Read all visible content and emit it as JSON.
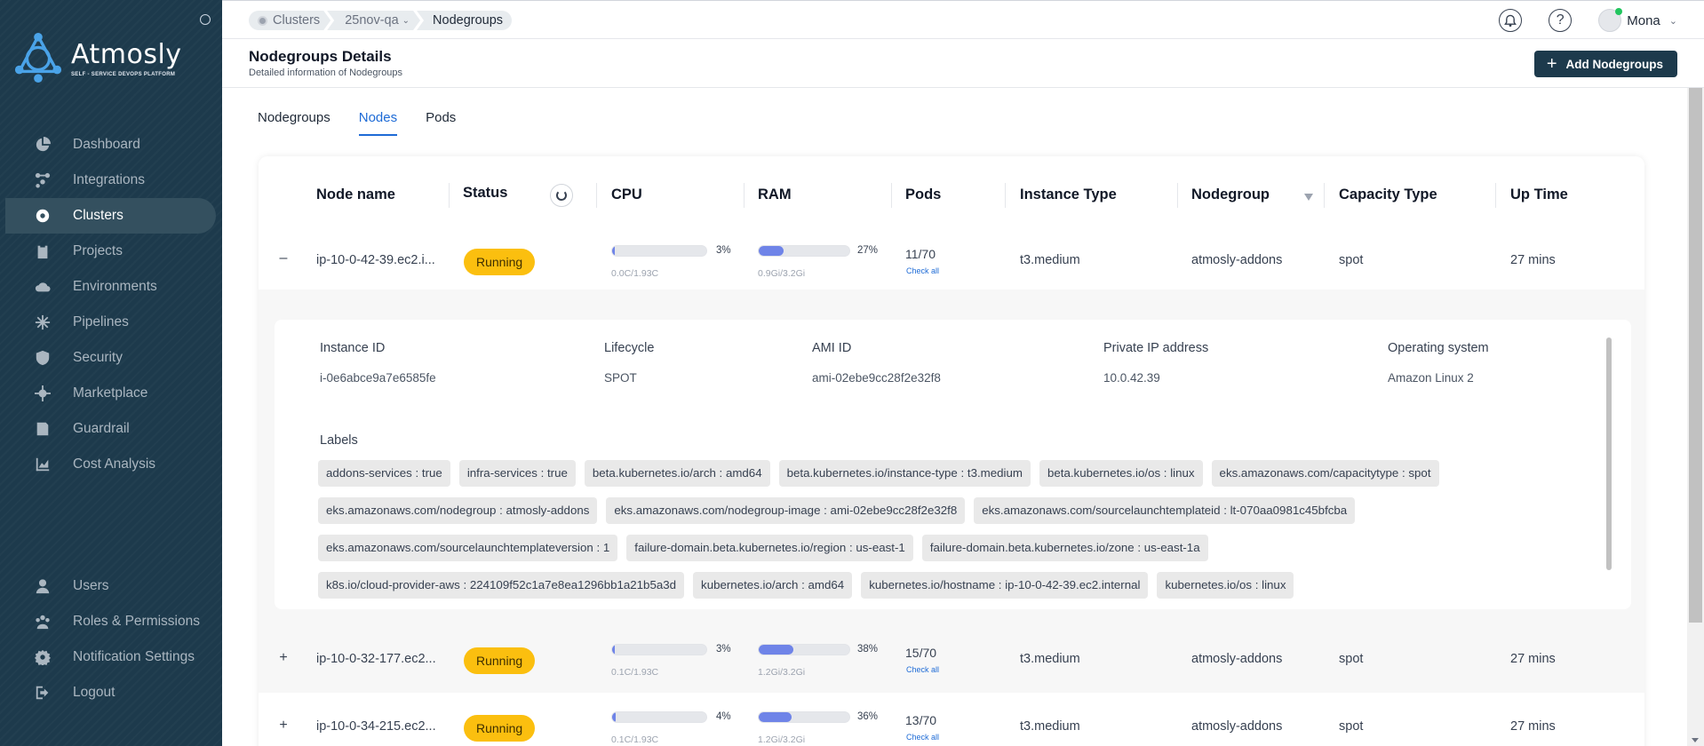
{
  "brand": {
    "name": "Atmosly",
    "tagline": "SELF - SERVICE DEVOPS PLATFORM"
  },
  "sidebar": {
    "items": [
      {
        "label": "Dashboard",
        "icon": "pie-chart-icon"
      },
      {
        "label": "Integrations",
        "icon": "integrations-icon"
      },
      {
        "label": "Clusters",
        "icon": "cluster-icon",
        "active": true
      },
      {
        "label": "Projects",
        "icon": "clipboard-icon"
      },
      {
        "label": "Environments",
        "icon": "cloud-upload-icon"
      },
      {
        "label": "Pipelines",
        "icon": "pipeline-icon"
      },
      {
        "label": "Security",
        "icon": "shield-icon"
      },
      {
        "label": "Marketplace",
        "icon": "marketplace-icon"
      },
      {
        "label": "Guardrail",
        "icon": "guardrail-icon"
      },
      {
        "label": "Cost Analysis",
        "icon": "cost-chart-icon"
      }
    ],
    "bottom_items": [
      {
        "label": "Users",
        "icon": "user-icon"
      },
      {
        "label": "Roles & Permissions",
        "icon": "roles-icon"
      },
      {
        "label": "Notification Settings",
        "icon": "gear-icon"
      },
      {
        "label": "Logout",
        "icon": "logout-icon"
      }
    ]
  },
  "breadcrumb": {
    "clusters": "Clusters",
    "cluster_name": "25nov-qa",
    "current": "Nodegroups"
  },
  "user": {
    "name": "Mona"
  },
  "header": {
    "title": "Nodegroups Details",
    "subtitle": "Detailed information of Nodegroups",
    "add_button": "Add Nodegroups"
  },
  "tabs": [
    "Nodegroups",
    "Nodes",
    "Pods"
  ],
  "active_tab": "Nodes",
  "table": {
    "columns": {
      "node_name": "Node name",
      "status": "Status",
      "cpu": "CPU",
      "ram": "RAM",
      "pods": "Pods",
      "instance_type": "Instance Type",
      "nodegroup": "Nodegroup",
      "capacity_type": "Capacity Type",
      "up_time": "Up Time"
    },
    "check_all": "Check all",
    "rows": [
      {
        "toggle": "–",
        "node_name": "ip-10-0-42-39.ec2.i...",
        "status": "Running",
        "cpu_pct": "3%",
        "cpu_fraction": 0.03,
        "cpu_usage": "0.0C/1.93C",
        "ram_pct": "27%",
        "ram_fraction": 0.27,
        "ram_usage": "0.9Gi/3.2Gi",
        "pods": "11/70",
        "instance_type": "t3.medium",
        "nodegroup": "atmosly-addons",
        "capacity_type": "spot",
        "up_time": "27 mins"
      },
      {
        "toggle": "+",
        "node_name": "ip-10-0-32-177.ec2...",
        "status": "Running",
        "cpu_pct": "3%",
        "cpu_fraction": 0.03,
        "cpu_usage": "0.1C/1.93C",
        "ram_pct": "38%",
        "ram_fraction": 0.38,
        "ram_usage": "1.2Gi/3.2Gi",
        "pods": "15/70",
        "instance_type": "t3.medium",
        "nodegroup": "atmosly-addons",
        "capacity_type": "spot",
        "up_time": "27 mins"
      },
      {
        "toggle": "+",
        "node_name": "ip-10-0-34-215.ec2...",
        "status": "Running",
        "cpu_pct": "4%",
        "cpu_fraction": 0.04,
        "cpu_usage": "0.1C/1.93C",
        "ram_pct": "36%",
        "ram_fraction": 0.36,
        "ram_usage": "1.2Gi/3.2Gi",
        "pods": "13/70",
        "instance_type": "t3.medium",
        "nodegroup": "atmosly-addons",
        "capacity_type": "spot",
        "up_time": "27 mins"
      }
    ]
  },
  "detail": {
    "fields": {
      "instance_id_label": "Instance ID",
      "instance_id": "i-0e6abce9a7e6585fe",
      "lifecycle_label": "Lifecycle",
      "lifecycle": "SPOT",
      "ami_id_label": "AMI ID",
      "ami_id": "ami-02ebe9cc28f2e32f8",
      "private_ip_label": "Private IP address",
      "private_ip": "10.0.42.39",
      "os_label": "Operating system",
      "os": "Amazon Linux 2"
    },
    "labels_title": "Labels",
    "labels": [
      [
        "addons-services : true",
        "infra-services : true",
        "beta.kubernetes.io/arch : amd64",
        "beta.kubernetes.io/instance-type : t3.medium",
        "beta.kubernetes.io/os : linux",
        "eks.amazonaws.com/capacitytype : spot"
      ],
      [
        "eks.amazonaws.com/nodegroup : atmosly-addons",
        "eks.amazonaws.com/nodegroup-image : ami-02ebe9cc28f2e32f8",
        "eks.amazonaws.com/sourcelaunchtemplateid : lt-070aa0981c45bfcba"
      ],
      [
        "eks.amazonaws.com/sourcelaunchtemplateversion : 1",
        "failure-domain.beta.kubernetes.io/region : us-east-1",
        "failure-domain.beta.kubernetes.io/zone : us-east-1a"
      ],
      [
        "k8s.io/cloud-provider-aws : 224109f52c1a7e8ea1296bb1a21b5a3d",
        "kubernetes.io/arch : amd64",
        "kubernetes.io/hostname : ip-10-0-42-39.ec2.internal",
        "kubernetes.io/os : linux"
      ]
    ]
  },
  "colors": {
    "sidebar": "#1d3a4c",
    "accent": "#1e6bd6",
    "running": "#fbbf0f",
    "bar": "#6f84e8"
  }
}
